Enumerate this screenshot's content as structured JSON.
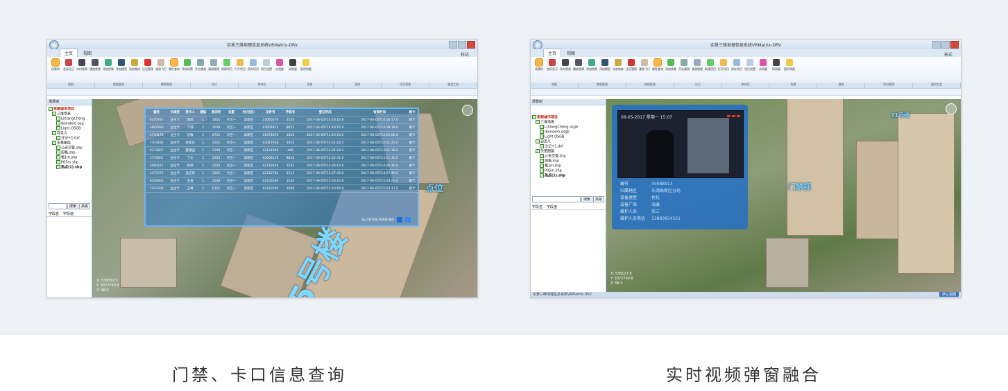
{
  "captions": {
    "left": "门禁、卡口信息查询",
    "right": "实时视频弹窗融合"
  },
  "app": {
    "title_left": "实景三维地理信息系统VRMatrix-DRV",
    "title_right": "实景三维地理信息系统VRMatrix-DRV",
    "tabs": [
      "主页",
      "视图"
    ],
    "style_label": "样式",
    "ribbon_groups": [
      "视图",
      "数据管理",
      "辅助管理",
      "注记",
      "单体化",
      "场景",
      "漫游",
      "项目管理",
      "量测工具"
    ],
    "ribbon_buttons": [
      "场景树",
      "坐标显示",
      "实时视频",
      "播放视频",
      "添加视频",
      "添加模型",
      "动态物体",
      "注记管理",
      "漫游飞行",
      "属性查询",
      "添加场景",
      "开启漫游",
      "漫游管理",
      "新建项目",
      "打开项目",
      "保存项目",
      "项目设置",
      "点测量",
      "线测量",
      "面积测量"
    ],
    "panel_title": "场景树",
    "search_button": "搜索",
    "advanced_button": "高级",
    "field_name_header": "字段名",
    "field_value_header": "字段值",
    "status_bar": "实景三维地理信息系统VRMatrix-DRV",
    "status_right": "默认视图"
  },
  "tree_left": {
    "root": "思想城市项目",
    "group1": "三维场景",
    "items1": [
      "LiXiangCheng",
      "domdem.osg",
      "Light.OSGB"
    ],
    "group2": "自定义",
    "items2": [
      "注记+1.dxf"
    ],
    "group3": "矢量图层",
    "items3": [
      "公安交警.shp",
      "周格.shp",
      "格1m.shp",
      "P05m.shp",
      "热点(1).shp"
    ]
  },
  "tree_right": {
    "root": "思想城市项目",
    "group1": "三维场景",
    "items1": [
      "LiXiangCheng.osgb",
      "domdem.osgb",
      "Light.OSGB"
    ],
    "group2": "自定义",
    "items2": [
      "注记+1.dxf"
    ],
    "group3": "矢量图层",
    "items3": [
      "公安交警.shp",
      "周格.shp",
      "格1m.shp",
      "P05m.shp",
      "热点(1).shp"
    ]
  },
  "grid": {
    "headers": [
      "编号",
      "卡类型",
      "持卡人",
      "楼栋",
      "房间号",
      "位置",
      "村(社区)",
      "证件号",
      "手机号",
      "登记时间",
      "有效时间",
      "刷卡"
    ],
    "rows": [
      [
        "8270787",
        "业主卡",
        "周阳",
        "1",
        "1401",
        "片区一",
        "高新区",
        "33060270",
        "1526",
        "2017-06-05T14:18:16.8",
        "2017-06-05T14:16:17.0",
        "刷卡"
      ],
      [
        "3487993",
        "业主卡",
        "下城",
        "1",
        "1509",
        "片区一",
        "高新区",
        "43001411",
        "8411",
        "2017-06-05T14:18:15.9",
        "2017-06-05T14:18:19.0",
        "刷卡"
      ],
      [
        "4730178",
        "业主卡",
        "孙敏",
        "1",
        "0701",
        "片区一",
        "高新区",
        "32071674",
        "1413",
        "2017-06-05T14:19:10.6",
        "2017-06-05T14:22:02.0",
        "刷卡"
      ],
      [
        "7703192",
        "业主卡",
        "梁新军",
        "1",
        "2101",
        "片区一",
        "高新区",
        "43017436",
        "1412",
        "2017-06-05T14:21:24.5",
        "2017-06-05T14:21:21.0",
        "刷卡"
      ],
      [
        "9173807",
        "业主卡",
        "董建国",
        "1",
        "2104",
        "片区一",
        "高新区",
        "43121920",
        "486",
        "2017-06-05T14:21:24.5",
        "2017-06-05T14:21:18.0",
        "刷卡"
      ],
      [
        "1774801",
        "业主卡",
        "丁文",
        "1",
        "2303",
        "片区一",
        "高新区",
        "42008119",
        "8810",
        "2017-06-05T14:22:41.6",
        "2017-06-05T14:21:31.0",
        "刷卡"
      ],
      [
        "3460427",
        "业主卡",
        "徐伟",
        "1",
        "2503",
        "片区一",
        "高新区",
        "42112819",
        "1525",
        "2017-06-05T14:26:14.9",
        "2017-06-05T14:26:16.0",
        "刷卡"
      ],
      [
        "1473375",
        "业主卡",
        "吴红伟",
        "1",
        "1302",
        "片区一",
        "高新区",
        "42112784",
        "1213",
        "2017-06-05T14:27:45.0",
        "2017-06-05T14:27:49.0",
        "刷卡"
      ],
      [
        "9526803",
        "业主卡",
        "王涛",
        "1",
        "2208",
        "片区一",
        "高新区",
        "42105260",
        "1534",
        "2017-06-05T15:53:14.8",
        "2017-06-05T15:53:21.0",
        "刷卡"
      ],
      [
        "7303709",
        "业主卡",
        "王峰",
        "1",
        "0101",
        "片区一",
        "高新区",
        "42110296",
        "1508",
        "2017-06-05T15:53:16.9",
        "2017-06-05T15:53:17.0",
        "刷卡"
      ]
    ],
    "pager": "显示1到10条,共38条,每页"
  },
  "scene_labels": {
    "left_big": "5号楼",
    "left_right": "点位",
    "right_gate": "门禁视",
    "right_top": "11号楼"
  },
  "popup": {
    "video_stamp": "06-05-2017 星期一 15:07",
    "fields": [
      {
        "k": "编号",
        "v": "00088913"
      },
      {
        "k": "归属辖区",
        "v": "东湖高新区分局"
      },
      {
        "k": "设备类型",
        "v": "枪机"
      },
      {
        "k": "设备厂商",
        "v": "海康"
      },
      {
        "k": "维护人员",
        "v": "张三"
      },
      {
        "k": "维护人员电话",
        "v": "13883654321"
      }
    ]
  },
  "coords_left": [
    "X: 538052.5",
    "Y: 3372760.8",
    "Z: 98.5"
  ],
  "coords_right": [
    "X: 538122.8",
    "Y: 3372760.6",
    "Z: 98.5"
  ]
}
